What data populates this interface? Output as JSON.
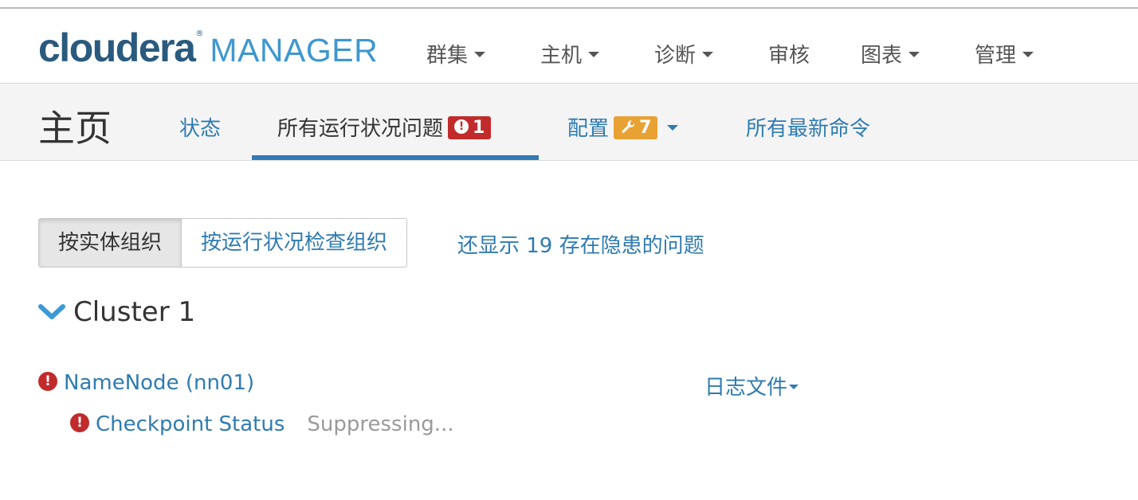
{
  "brand": {
    "cloudera": "cloudera",
    "registered": "®",
    "manager": "MANAGER"
  },
  "nav": {
    "menus": [
      {
        "label": "群集",
        "has_caret": true
      },
      {
        "label": "主机",
        "has_caret": true
      },
      {
        "label": "诊断",
        "has_caret": true
      },
      {
        "label": "审核",
        "has_caret": false
      },
      {
        "label": "图表",
        "has_caret": true
      },
      {
        "label": "管理",
        "has_caret": true
      }
    ]
  },
  "page": {
    "title": "主页",
    "tabs": {
      "status": "状态",
      "health_issues": {
        "label": "所有运行状况问题",
        "badge_icon": "exclamation-icon",
        "badge_count": "1"
      },
      "config": {
        "label": "配置",
        "badge_icon": "wrench-icon",
        "badge_count": "7"
      },
      "commands": "所有最新命令"
    }
  },
  "toolbar": {
    "by_entity": "按实体组织",
    "by_health_check": "按运行状况检查组织",
    "show_hidden_link": "还显示 19 存在隐患的问题"
  },
  "cluster": {
    "name": "Cluster 1",
    "entity": {
      "name": "NameNode (nn01)",
      "logs_label": "日志文件"
    },
    "check": {
      "name": "Checkpoint Status",
      "state": "Suppressing..."
    }
  },
  "colors": {
    "link": "#2f7bb1",
    "error": "#c12b2b",
    "warning": "#e8a233",
    "active_tab": "#337ab7",
    "brand_dark": "#2a5a7e",
    "brand_light": "#3d97d0"
  }
}
